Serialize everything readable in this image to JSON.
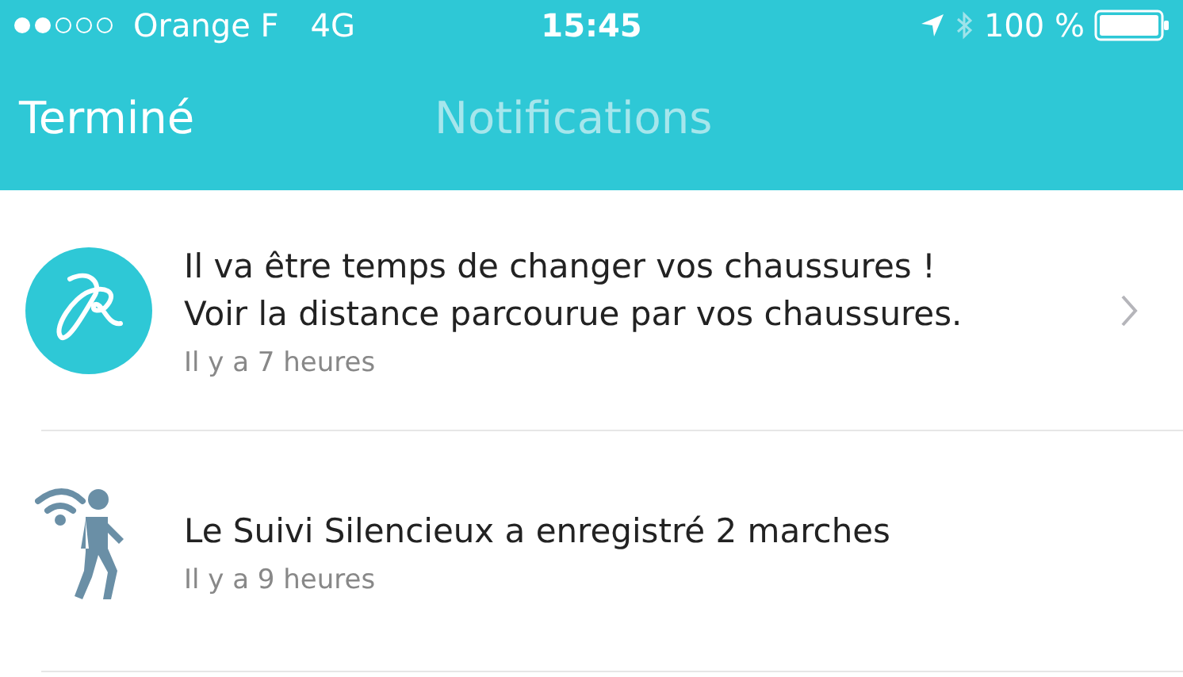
{
  "status_bar": {
    "carrier": "Orange F",
    "network": "4G",
    "time": "15:45",
    "battery": "100 %"
  },
  "nav": {
    "back": "Terminé",
    "title": "Notifications"
  },
  "notifications": [
    {
      "kind": "app",
      "lines": [
        "Il va être temps de changer vos chaussures !",
        "Voir la distance parcourue par vos chaussures."
      ],
      "time": "Il y a 7 heures",
      "chevron": true
    },
    {
      "kind": "walk",
      "lines": [
        "Le Suivi Silencieux a enregistré 2 marches"
      ],
      "time": "Il y a 9 heures",
      "chevron": false
    }
  ]
}
